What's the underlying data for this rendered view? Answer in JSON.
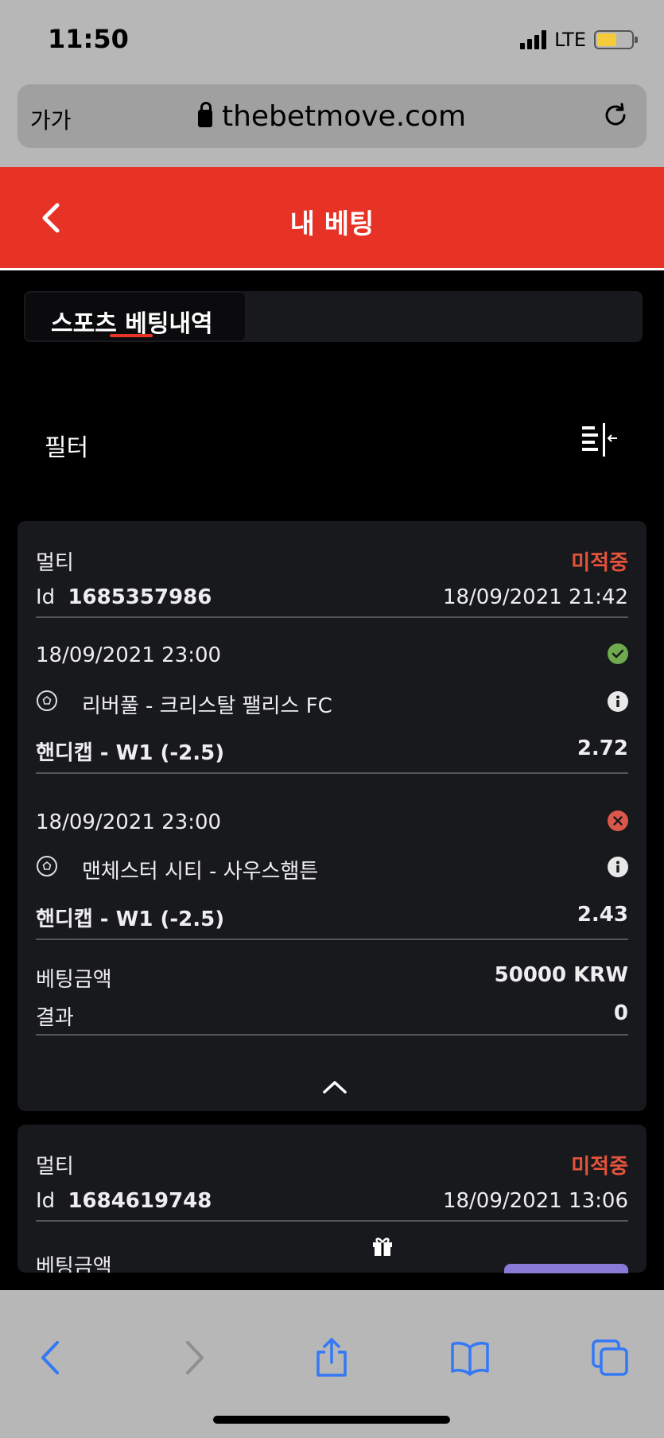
{
  "status_bar": {
    "time": "11:50",
    "network": "LTE"
  },
  "address_bar": {
    "text_size": "가가",
    "url": "thebetmove.com"
  },
  "header": {
    "title": "내 베팅"
  },
  "tabs": [
    {
      "label": "스포츠 베팅내역",
      "active": true
    }
  ],
  "filter": {
    "label": "필터"
  },
  "bets": [
    {
      "type": "멀티",
      "status": "미적중",
      "id_label": "Id",
      "id": "1685357986",
      "placed_at": "18/09/2021 21:42",
      "selections": [
        {
          "datetime": "18/09/2021 23:00",
          "result_icon": "check-circle-icon",
          "event": "리버풀 - 크리스탈 팰리스 FC",
          "market": "핸디캡 - W1 (-2.5)",
          "odds": "2.72"
        },
        {
          "datetime": "18/09/2021 23:00",
          "result_icon": "x-circle-icon",
          "event": "맨체스터 시티 - 사우스햄튼",
          "market": "핸디캡 - W1 (-2.5)",
          "odds": "2.43"
        }
      ],
      "stake_label": "베팅금액",
      "stake": "50000 KRW",
      "result_label": "결과",
      "result": "0"
    },
    {
      "type": "멀티",
      "status": "미적중",
      "id_label": "Id",
      "id": "1684619748",
      "placed_at": "18/09/2021 13:06",
      "stake_label": "베팅금액"
    }
  ],
  "colors": {
    "brand_red": "#e63325",
    "status_red": "#e5533b",
    "success_green": "#6faa4e",
    "promo_purple": "#8a7ad8"
  }
}
